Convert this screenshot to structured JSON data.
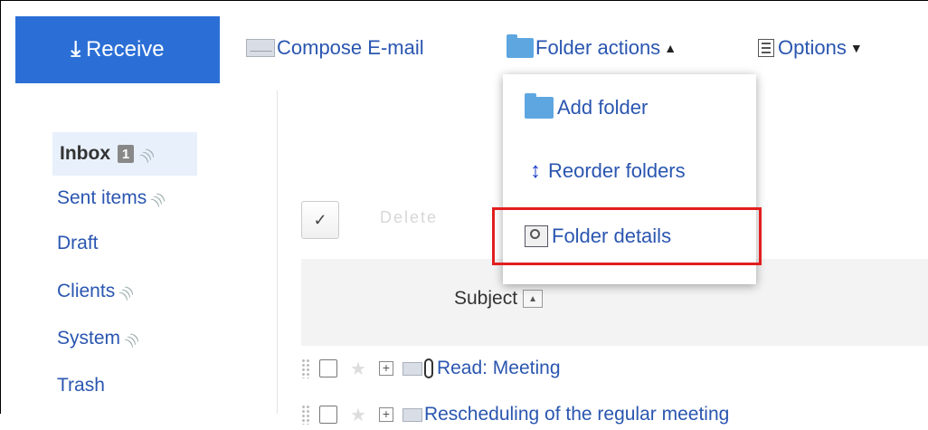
{
  "toolbar": {
    "receive_label": "Receive",
    "receive_icon": "download-icon",
    "compose_label": "Compose E-mail",
    "folder_actions_label": "Folder actions",
    "folder_actions_caret": "▲",
    "options_label": "Options",
    "options_caret": "▼"
  },
  "sidebar": {
    "items": [
      {
        "label": "Inbox",
        "badge": "1",
        "selected": true
      },
      {
        "label": "Sent items"
      },
      {
        "label": "Draft"
      },
      {
        "label": "Clients"
      },
      {
        "label": "System"
      },
      {
        "label": "Trash"
      }
    ]
  },
  "main": {
    "check_all_glyph": "✓",
    "delete_label": "Delete",
    "column_subject": "Subject",
    "sort_glyph": "▲",
    "rows": [
      {
        "subject": "Read: Meeting",
        "expand": "+"
      },
      {
        "subject": "Rescheduling of the regular meeting",
        "expand": "+"
      }
    ]
  },
  "dropdown": {
    "items": [
      {
        "label": "Add folder",
        "icon": "folder-icon"
      },
      {
        "label": "Reorder folders",
        "icon": "reorder-icon"
      },
      {
        "label": "Folder details",
        "icon": "folder-details-icon",
        "highlighted": true
      }
    ]
  },
  "colors": {
    "primary": "#2b6fd6",
    "link": "#2a56b0",
    "highlight": "#e21e1e"
  }
}
